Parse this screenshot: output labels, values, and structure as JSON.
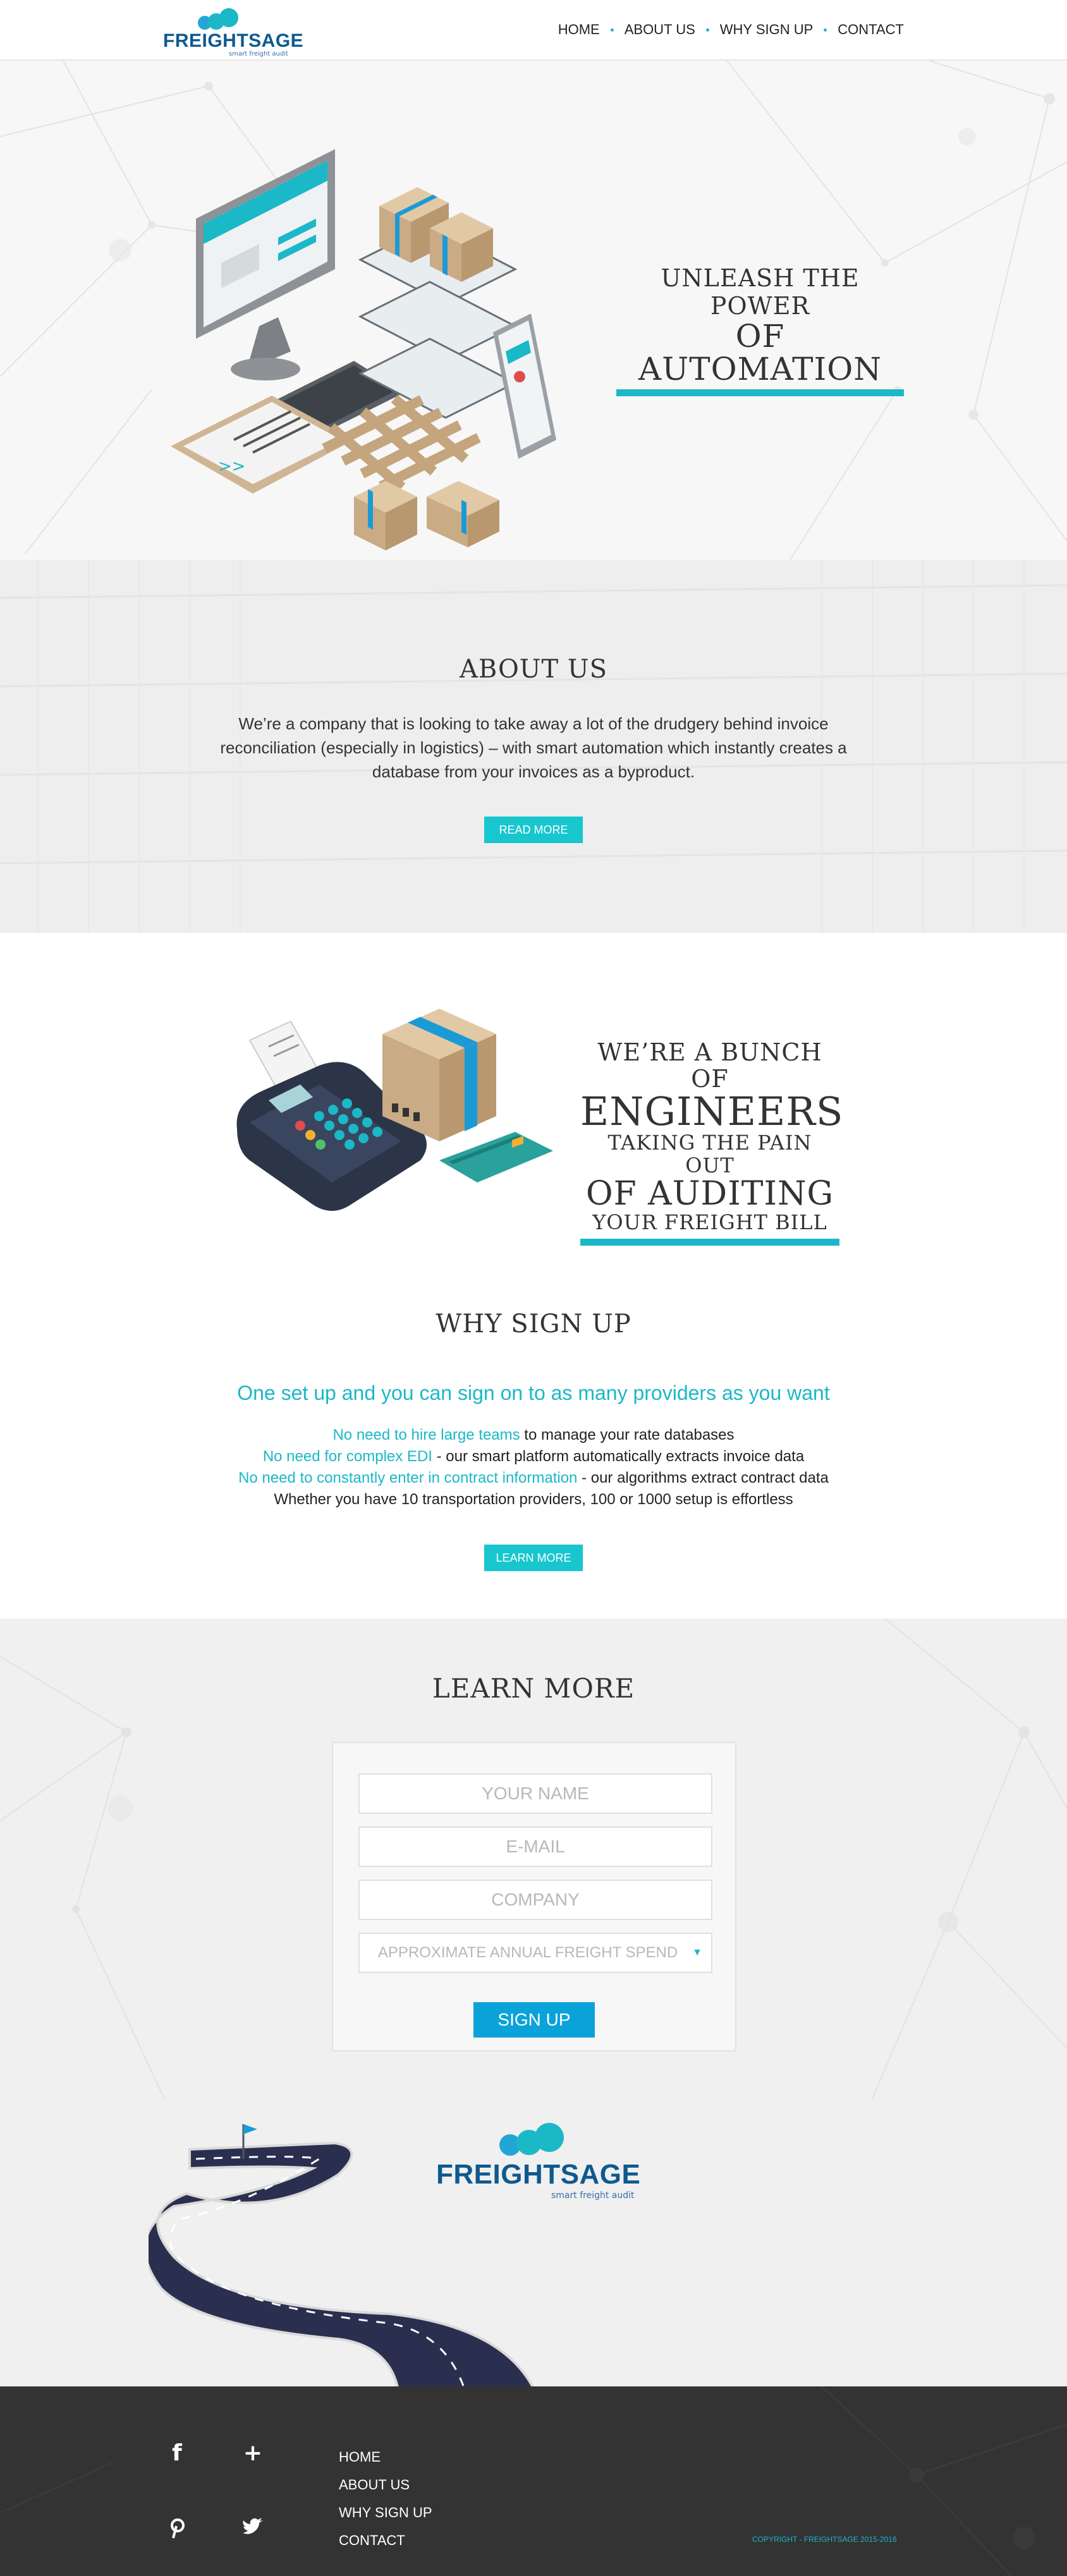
{
  "brand": {
    "name": "FREIGHTSAGE",
    "tagline": "smart freight audit",
    "accent_color": "#1bb8c7",
    "logo_blue": "#0e5a8f"
  },
  "nav": {
    "items": [
      {
        "label": "HOME"
      },
      {
        "label": "ABOUT US"
      },
      {
        "label": "WHY SIGN UP"
      },
      {
        "label": "CONTACT"
      }
    ]
  },
  "hero": {
    "title_line1": "UNLEASH THE POWER",
    "title_line2": "OF AUTOMATION",
    "illustration_icon": "automation-illustration-icon"
  },
  "about": {
    "heading": "ABOUT US",
    "body": "We’re a company that is looking to take away a lot of the drudgery behind invoice reconciliation (especially in logistics) – with smart automation which instantly creates a database from your invoices as a byproduct.",
    "button": "READ MORE"
  },
  "engineers": {
    "line1": "WE’RE A BUNCH OF",
    "line2": "ENGINEERS",
    "line3": "TAKING THE PAIN OUT",
    "line4": "OF AUDITING",
    "line5": "YOUR FREIGHT BILL",
    "illustration_icon": "payment-terminal-illustration-icon"
  },
  "why": {
    "heading": "WHY SIGN UP",
    "lead": "One set up and you can sign on to as many providers as you want",
    "points": [
      {
        "highlight": "No need to hire large teams",
        "rest": " to manage your rate databases"
      },
      {
        "highlight": "No need for complex EDI",
        "rest": " - our smart platform automatically extracts invoice data"
      },
      {
        "highlight": "No need to constantly enter in contract information",
        "rest": " - our algorithms extract contract data"
      }
    ],
    "closing": "Whether you have 10 transportation providers, 100 or 1000 setup is effortless",
    "button": "LEARN MORE"
  },
  "learn": {
    "heading": "LEARN MORE",
    "fields": {
      "name_placeholder": "YOUR NAME",
      "email_placeholder": "E-MAIL",
      "company_placeholder": "COMPANY",
      "spend_selected": "APPROXIMATE ANNUAL FREIGHT SPEND"
    },
    "submit": "SIGN UP"
  },
  "footer": {
    "social_icons": [
      "facebook-icon",
      "plus-icon",
      "pinterest-icon",
      "twitter-icon"
    ],
    "links": [
      {
        "label": "HOME"
      },
      {
        "label": "ABOUT US"
      },
      {
        "label": "WHY SIGN UP"
      },
      {
        "label": "CONTACT"
      }
    ],
    "copyright": "COPYRIGHT - FREIGHTSAGE 2015-2016"
  }
}
